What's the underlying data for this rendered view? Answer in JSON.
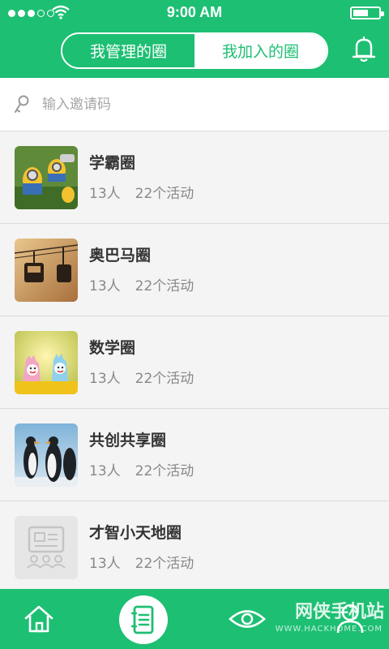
{
  "status_bar": {
    "time": "9:00 AM"
  },
  "header": {
    "tabs": [
      {
        "label": "我管理的圈",
        "active": true
      },
      {
        "label": "我加入的圈",
        "active": false
      }
    ],
    "icons": [
      "bell-icon"
    ]
  },
  "search": {
    "placeholder": "输入邀请码",
    "value": "",
    "icon": "key-icon"
  },
  "circles": [
    {
      "name": "学霸圈",
      "members": "13人",
      "activities": "22个活动"
    },
    {
      "name": "奥巴马圈",
      "members": "13人",
      "activities": "22个活动"
    },
    {
      "name": "数学圈",
      "members": "13人",
      "activities": "22个活动"
    },
    {
      "name": "共创共享圈",
      "members": "13人",
      "activities": "22个活动"
    },
    {
      "name": "才智小天地圈",
      "members": "13人",
      "activities": "22个活动"
    }
  ],
  "bottom_nav": {
    "items": [
      "home-icon",
      "notebook-icon",
      "eye-icon",
      "user-icon"
    ]
  },
  "watermark": {
    "text": "网侠手机站",
    "url": "WWW.HACKHOME.COM"
  },
  "colors": {
    "accent": "#1dbf73",
    "background": "#f4f4f4"
  }
}
